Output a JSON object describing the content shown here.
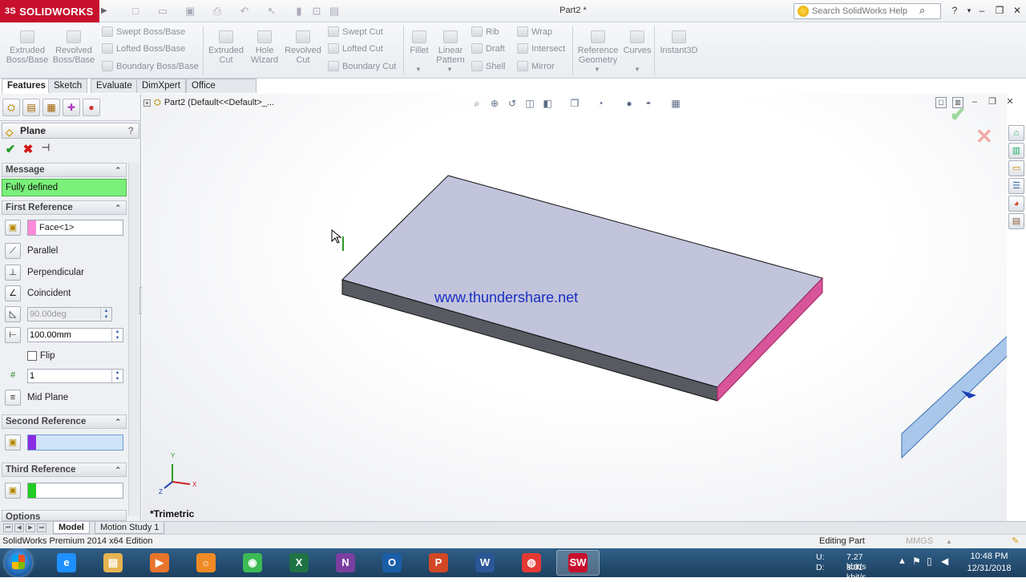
{
  "app": {
    "brand": "SOLIDWORKS",
    "brand_prefix": "3S",
    "document_title": "Part2 *",
    "search_placeholder": "Search SolidWorks Help"
  },
  "toolbar": {
    "extruded_boss": "Extruded Boss/Base",
    "revolved_boss": "Revolved Boss/Base",
    "swept_boss": "Swept Boss/Base",
    "lofted_boss": "Lofted Boss/Base",
    "boundary_boss": "Boundary Boss/Base",
    "extruded_cut": "Extruded Cut",
    "hole_wizard": "Hole Wizard",
    "revolved_cut": "Revolved Cut",
    "swept_cut": "Swept Cut",
    "lofted_cut": "Lofted Cut",
    "boundary_cut": "Boundary Cut",
    "fillet": "Fillet",
    "linear_pattern": "Linear Pattern",
    "rib": "Rib",
    "draft": "Draft",
    "shell": "Shell",
    "wrap": "Wrap",
    "intersect": "Intersect",
    "mirror": "Mirror",
    "reference_geometry": "Reference Geometry",
    "curves": "Curves",
    "instant3d": "Instant3D"
  },
  "tabs": [
    "Features",
    "Sketch",
    "Evaluate",
    "DimXpert",
    "Office Products"
  ],
  "property_manager": {
    "title": "Plane",
    "help": "?",
    "message_header": "Message",
    "message": "Fully defined",
    "first_reference": {
      "header": "First Reference",
      "selection": "Face<1>",
      "parallel": "Parallel",
      "perpendicular": "Perpendicular",
      "coincident": "Coincident",
      "angle": "90.00deg",
      "distance": "100.00mm",
      "flip": "Flip",
      "count": "1",
      "mid_plane": "Mid Plane"
    },
    "second_reference": {
      "header": "Second Reference",
      "swatch_color": "#8a2be2"
    },
    "third_reference": {
      "header": "Third Reference",
      "swatch_color": "#22cc22"
    },
    "options_header": "Options",
    "first_swatch_color": "#ff8ad8"
  },
  "viewport": {
    "tree_item": "Part2  (Default<<Default>_...",
    "watermark": "www.thundershare.net",
    "view_name": "*Trimetric",
    "triad": {
      "x": "X",
      "y": "Y",
      "z": "Z"
    },
    "colors": {
      "top_face": "#c2c4dc",
      "side_face": "#575a61",
      "selected_face": "#d9559a",
      "plane": "#8fb7e6"
    }
  },
  "bottom_tabs": [
    "Model",
    "Motion Study 1"
  ],
  "status": {
    "edition": "SolidWorks Premium 2014 x64 Edition",
    "mode": "Editing Part",
    "units": "MMGS",
    "units_arrow": "▲"
  },
  "taskbar": {
    "apps": [
      {
        "name": "internet-explorer",
        "glyph": "e",
        "color": "#1e90ff"
      },
      {
        "name": "file-explorer",
        "glyph": "▤",
        "color": "#e6b450"
      },
      {
        "name": "media-player",
        "glyph": "▶",
        "color": "#e8752c"
      },
      {
        "name": "browser-2",
        "glyph": "☼",
        "color": "#f08a24"
      },
      {
        "name": "chrome",
        "glyph": "◉",
        "color": "#3cba54"
      },
      {
        "name": "excel",
        "glyph": "X",
        "color": "#1f7244"
      },
      {
        "name": "onenote",
        "glyph": "N",
        "color": "#7b3fa0"
      },
      {
        "name": "outlook",
        "glyph": "O",
        "color": "#1a5ea8"
      },
      {
        "name": "powerpoint",
        "glyph": "P",
        "color": "#d24726"
      },
      {
        "name": "word",
        "glyph": "W",
        "color": "#2b5797"
      },
      {
        "name": "screen-recorder",
        "glyph": "◍",
        "color": "#e53935"
      },
      {
        "name": "solidworks",
        "glyph": "SW",
        "color": "#c8102e"
      }
    ],
    "net_up_label": "U:",
    "net_down_label": "D:",
    "net_up": "7.27 kbit/s",
    "net_down": "3.01 kbit/s",
    "time": "10:48 PM",
    "date": "12/31/2018"
  }
}
